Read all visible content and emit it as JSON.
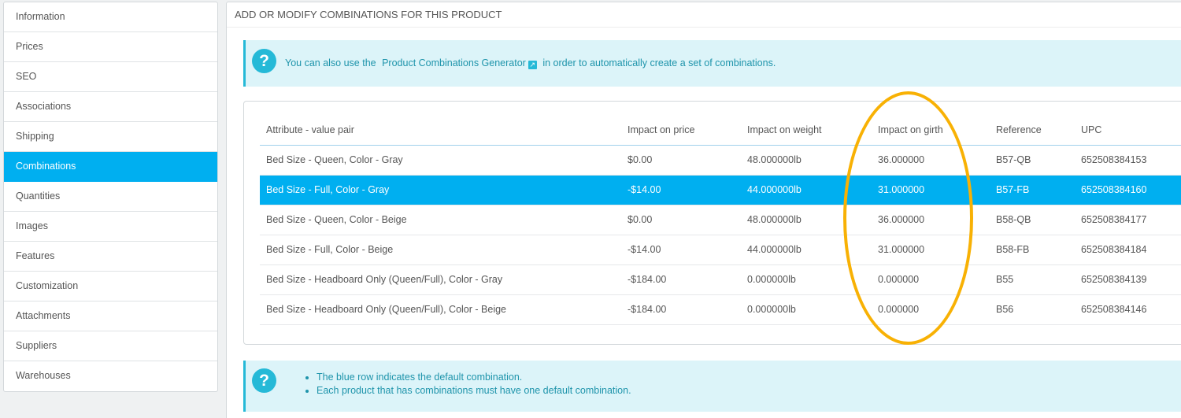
{
  "sidebar": {
    "items": [
      {
        "label": "Information",
        "active": false
      },
      {
        "label": "Prices",
        "active": false
      },
      {
        "label": "SEO",
        "active": false
      },
      {
        "label": "Associations",
        "active": false
      },
      {
        "label": "Shipping",
        "active": false
      },
      {
        "label": "Combinations",
        "active": true
      },
      {
        "label": "Quantities",
        "active": false
      },
      {
        "label": "Images",
        "active": false
      },
      {
        "label": "Features",
        "active": false
      },
      {
        "label": "Customization",
        "active": false
      },
      {
        "label": "Attachments",
        "active": false
      },
      {
        "label": "Suppliers",
        "active": false
      },
      {
        "label": "Warehouses",
        "active": false
      }
    ]
  },
  "panel": {
    "title": "ADD OR MODIFY COMBINATIONS FOR THIS PRODUCT"
  },
  "info_alert": {
    "icon": "help-icon",
    "prefix": "You can also use the",
    "link_label": "Product Combinations Generator",
    "suffix": "in order to automatically create a set of combinations."
  },
  "table": {
    "headers": [
      "Attribute - value pair",
      "Impact on price",
      "Impact on weight",
      "Impact on girth",
      "Reference",
      "UPC"
    ],
    "rows": [
      {
        "cells": [
          "Bed Size - Queen, Color - Gray",
          "$0.00",
          "48.000000lb",
          "36.000000",
          "B57-QB",
          "652508384153"
        ],
        "default": false
      },
      {
        "cells": [
          "Bed Size - Full, Color - Gray",
          "-$14.00",
          "44.000000lb",
          "31.000000",
          "B57-FB",
          "652508384160"
        ],
        "default": true
      },
      {
        "cells": [
          "Bed Size - Queen, Color - Beige",
          "$0.00",
          "48.000000lb",
          "36.000000",
          "B58-QB",
          "652508384177"
        ],
        "default": false
      },
      {
        "cells": [
          "Bed Size - Full, Color - Beige",
          "-$14.00",
          "44.000000lb",
          "31.000000",
          "B58-FB",
          "652508384184"
        ],
        "default": false
      },
      {
        "cells": [
          "Bed Size - Headboard Only (Queen/Full), Color - Gray",
          "-$184.00",
          "0.000000lb",
          "0.000000",
          "B55",
          "652508384139"
        ],
        "default": false
      },
      {
        "cells": [
          "Bed Size - Headboard Only (Queen/Full), Color - Beige",
          "-$184.00",
          "0.000000lb",
          "0.000000",
          "B56",
          "652508384146"
        ],
        "default": false
      }
    ]
  },
  "help_alert": {
    "icon": "help-icon",
    "items": [
      "The blue row indicates the default combination.",
      "Each product that has combinations must have one default combination."
    ]
  },
  "colors": {
    "accent": "#00aff0",
    "info_bg": "#dcf4f9",
    "info_text": "#1e94ab",
    "annotation": "#f8b104"
  }
}
